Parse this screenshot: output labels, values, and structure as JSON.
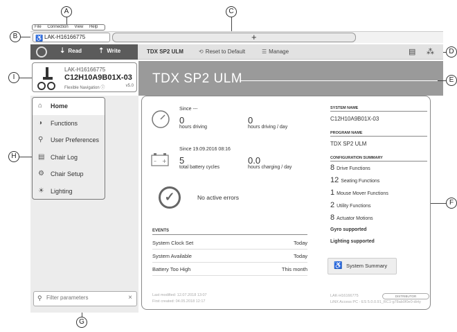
{
  "menu": [
    "File",
    "Connection",
    "View",
    "Help"
  ],
  "tab": {
    "label": "LAK-H16166775",
    "add": "+"
  },
  "toolbar": {
    "read": "Read",
    "write": "Write",
    "model": "TDX SP2 ULM",
    "reset": "Reset to Default",
    "manage": "Manage"
  },
  "device": {
    "serial": "LAK-H16166775",
    "model": "C12H10A9B01X-03",
    "nav": "Flexible Navigation",
    "version": "v5.0"
  },
  "page_title": "TDX SP2 ULM",
  "nav": [
    {
      "label": "Home",
      "icon": "home-icon"
    },
    {
      "label": "Functions",
      "icon": "functions-icon"
    },
    {
      "label": "User Preferences",
      "icon": "user-icon"
    },
    {
      "label": "Chair Log",
      "icon": "log-icon"
    },
    {
      "label": "Chair Setup",
      "icon": "setup-icon"
    },
    {
      "label": "Lighting",
      "icon": "lighting-icon"
    }
  ],
  "filter": {
    "placeholder": "Filter parameters"
  },
  "stats": {
    "drive_since": "Since ---",
    "hours_driving": "0",
    "hours_driving_label": "hours driving",
    "hours_day": "0",
    "hours_day_label": "hours driving / day",
    "battery_since": "Since 19.09.2016 08:16",
    "cycles": "5",
    "cycles_label": "total battery cycles",
    "charging": "0.0",
    "charging_label": "hours charging / day"
  },
  "errors": "No active errors",
  "events": {
    "heading": "EVENTS",
    "rows": [
      {
        "name": "System Clock Set",
        "when": "Today"
      },
      {
        "name": "System Available",
        "when": "Today"
      },
      {
        "name": "Battery Too High",
        "when": "This month"
      }
    ]
  },
  "footer_left": {
    "modified": "Last modified: 12.07.2018 13:07",
    "created": "First created: 04.05.2018 12:17"
  },
  "system": {
    "name_heading": "SYSTEM NAME",
    "name": "C12H10A9B01X-03",
    "program_heading": "PROGRAM NAME",
    "program": "TDX SP2 ULM",
    "config_heading": "CONFIGURATION SUMMARY",
    "config": [
      {
        "count": "8",
        "label": "Drive Functions"
      },
      {
        "count": "12",
        "label": "Seating Functions"
      },
      {
        "count": "1",
        "label": "Mouse Mover Functions"
      },
      {
        "count": "2",
        "label": "Utility Functions"
      },
      {
        "count": "8",
        "label": "Actuator Motions"
      }
    ],
    "gyro": "Gyro supported",
    "lighting": "Lighting supported",
    "summary_button": "System Summary"
  },
  "footer_right": {
    "serial": "LAK-H16166775",
    "distributor": "DISTRIBUTOR",
    "access": "LiNX Access PC - ES 5.0.0.91_RC1-g78ab0f0e0-dirty"
  },
  "callouts": [
    "A",
    "B",
    "C",
    "D",
    "E",
    "F",
    "G",
    "H",
    "I"
  ]
}
